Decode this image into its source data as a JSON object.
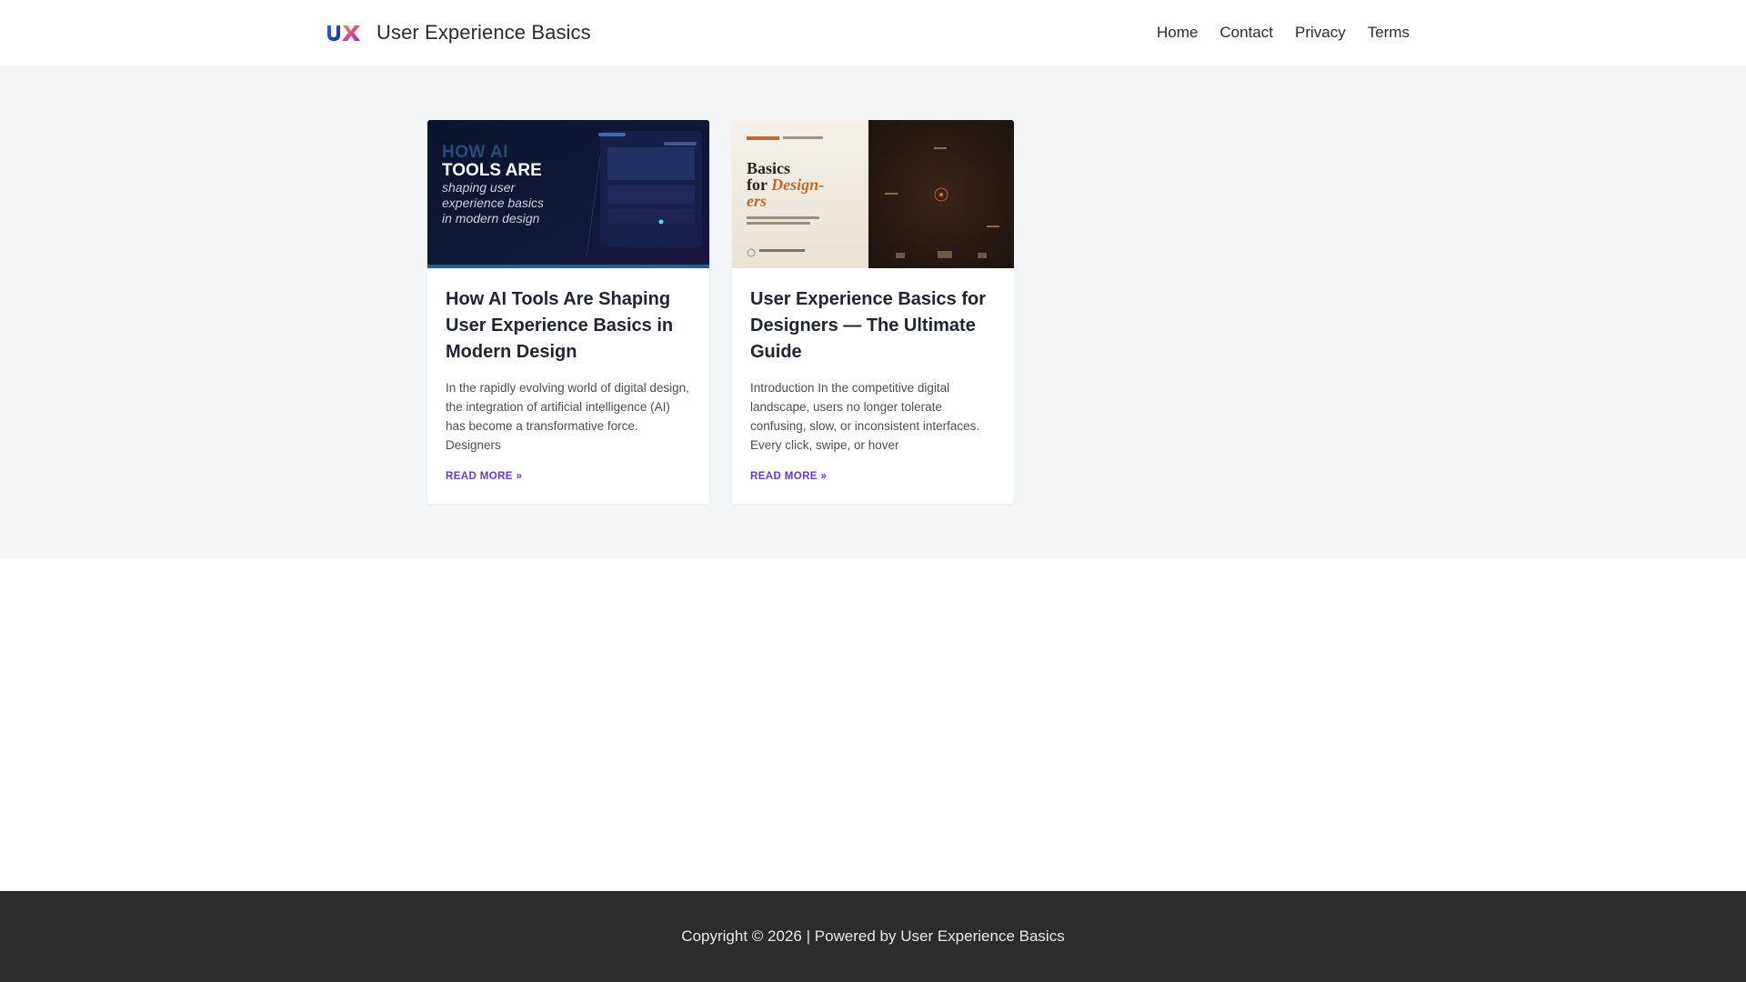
{
  "header": {
    "site_title": "User Experience Basics",
    "logo_icon": "ux-logo-icon",
    "nav": [
      {
        "label": "Home"
      },
      {
        "label": "Contact"
      },
      {
        "label": "Privacy"
      },
      {
        "label": "Terms"
      }
    ]
  },
  "posts": [
    {
      "title": "How AI Tools Are Shaping User Experience Basics in Modern Design",
      "excerpt": "In the rapidly evolving world of digital design, the integration of artificial intelligence (AI) has become a transformative force. Designers",
      "read_more": "READ MORE »",
      "thumb": {
        "line1": "HOW AI",
        "line2": "TOOLS ARE",
        "line3": "shaping user",
        "line4": "experience basics",
        "line5": "in modern design"
      }
    },
    {
      "title": "User Experience Basics for Designers — The Ultimate Guide",
      "excerpt": "Introduction In the competitive digital landscape, users no longer tolerate confusing, slow, or inconsistent interfaces. Every click, swipe, or hover",
      "read_more": "READ MORE »",
      "thumb": {
        "line1": "Basics",
        "line2": "for",
        "line3": "Design-",
        "line4": "ers"
      }
    }
  ],
  "footer": {
    "copyright": "Copyright © 2026",
    "separator": "|",
    "powered": "Powered by User Experience Basics"
  },
  "colors": {
    "accent": "#6a3bb8",
    "content_bg": "#f3f5f7",
    "footer_bg": "#2c2c2c"
  }
}
